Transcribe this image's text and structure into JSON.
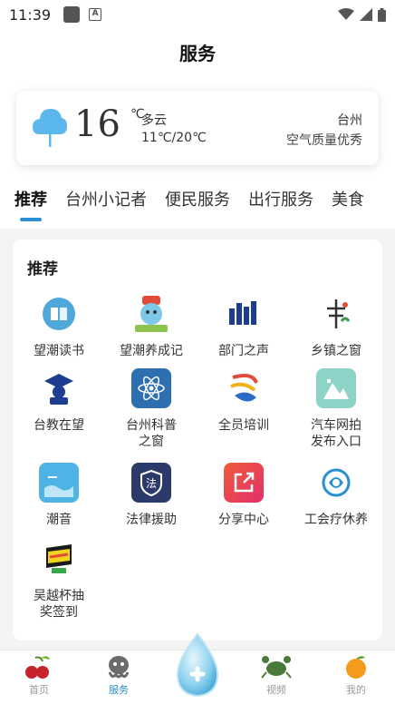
{
  "status": {
    "time": "11:39"
  },
  "header": {
    "title": "服务"
  },
  "weather": {
    "temp": "16",
    "unit": "℃",
    "condition": "多云",
    "range": "11℃/20℃",
    "city": "台州",
    "air_quality": "空气质量优秀"
  },
  "tabs": [
    {
      "label": "推荐"
    },
    {
      "label": "台州小记者"
    },
    {
      "label": "便民服务"
    },
    {
      "label": "出行服务"
    },
    {
      "label": "美食"
    }
  ],
  "panel": {
    "title": "推荐",
    "items": [
      {
        "label": "望潮读书",
        "icon": "book-icon"
      },
      {
        "label": "望潮养成记",
        "icon": "mascot-icon"
      },
      {
        "label": "部门之声",
        "icon": "building-icon"
      },
      {
        "label": "乡镇之窗",
        "icon": "village-icon"
      },
      {
        "label": "台教在望",
        "icon": "graduate-icon"
      },
      {
        "label": "台州科普\n之窗",
        "icon": "atom-icon"
      },
      {
        "label": "全员培训",
        "icon": "training-icon"
      },
      {
        "label": "汽车网拍\n发布入口",
        "icon": "car-mountain-icon"
      },
      {
        "label": "潮音",
        "icon": "wave-icon"
      },
      {
        "label": "法律援助",
        "icon": "law-icon"
      },
      {
        "label": "分享中心",
        "icon": "share-icon"
      },
      {
        "label": "工会疗休养",
        "icon": "union-icon"
      },
      {
        "label": "吴越杯抽\n奖签到",
        "icon": "lottery-icon"
      }
    ]
  },
  "nav": {
    "items": [
      {
        "label": "首页",
        "icon": "cherry-icon"
      },
      {
        "label": "服务",
        "icon": "octopus-icon"
      },
      {
        "label": "",
        "icon": "water-drop-plus-icon"
      },
      {
        "label": "视频",
        "icon": "crab-icon"
      },
      {
        "label": "我的",
        "icon": "orange-icon"
      }
    ]
  },
  "colors": {
    "accent": "#2a8fd0"
  }
}
